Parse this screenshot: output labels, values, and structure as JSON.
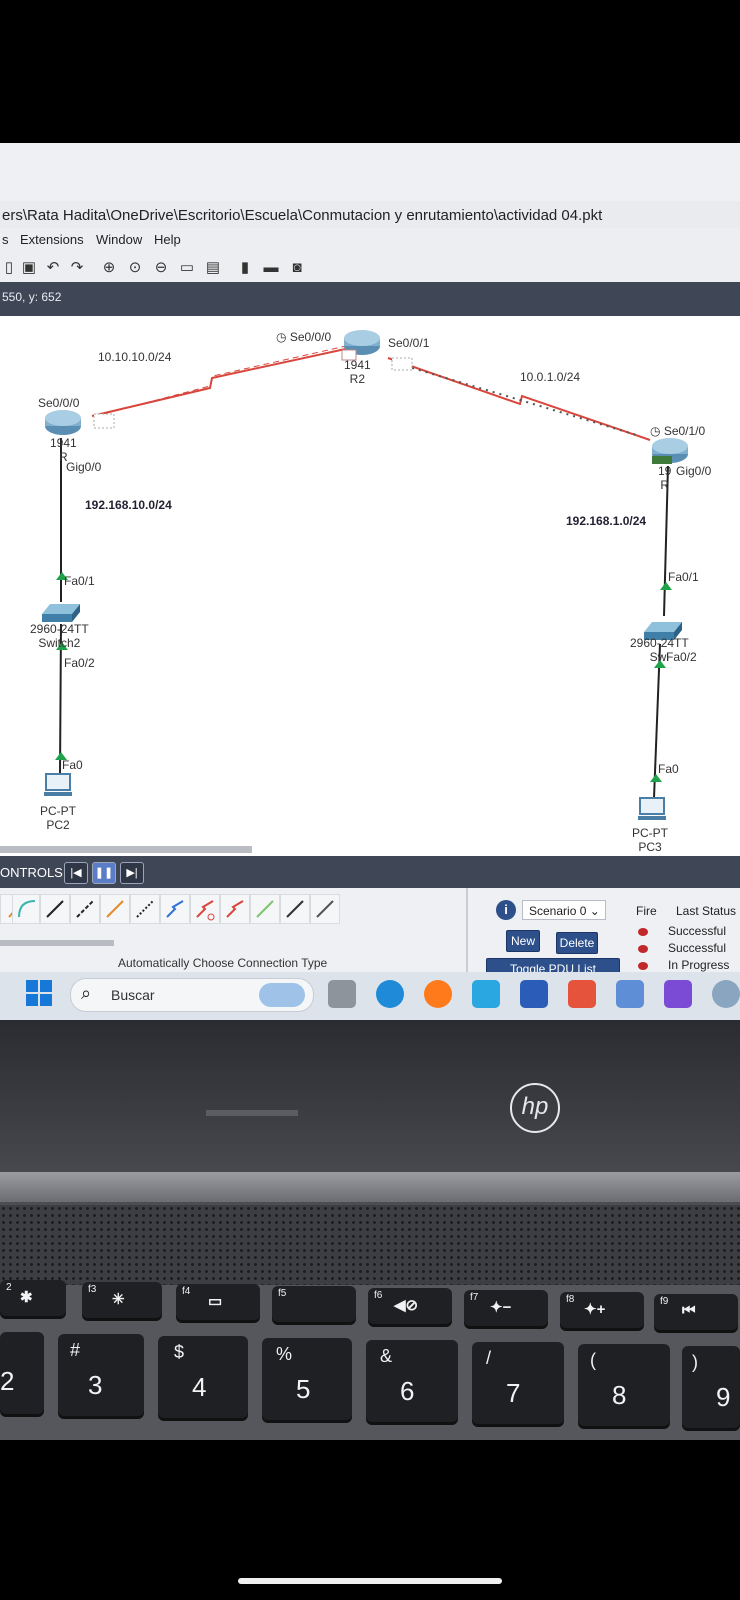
{
  "window": {
    "title_path": "ers\\Rata Hadita\\OneDrive\\Escritorio\\Escuela\\Conmutacion y enrutamiento\\actividad 04.pkt"
  },
  "menu": [
    "s",
    "Extensions",
    "Window",
    "Help"
  ],
  "coords": "550, y: 652",
  "topology": {
    "networks": {
      "net_left_serial": "10.10.10.0/24",
      "net_right_serial": "10.0.1.0/24",
      "lan_left": "192.168.10.0/24",
      "lan_right": "192.168.1.0/24"
    },
    "r2": {
      "model": "1941",
      "name": "R2",
      "port_left": "Se0/0/0",
      "port_right": "Se0/0/1"
    },
    "r1": {
      "model": "1941",
      "name": "R",
      "port_serial": "Se0/0/0",
      "port_gig": "Gig0/0"
    },
    "r3": {
      "model": "19",
      "name": "R",
      "port_serial": "Se0/1/0",
      "port_gig": "Gig0/0"
    },
    "switch2": {
      "model": "2960-24TT",
      "name": "Switch2",
      "port_up": "Fa0/1",
      "port_down": "Fa0/2"
    },
    "switch3": {
      "model": "2960-24TT",
      "name": "Swi",
      "port_up": "Fa0/1",
      "port_down": "Fa0/2"
    },
    "pc2": {
      "type": "PC-PT",
      "name": "PC2",
      "port": "Fa0"
    },
    "pc3": {
      "type": "PC-PT",
      "name": "PC3",
      "port": "Fa0"
    }
  },
  "controls": {
    "label": "ONTROLS:",
    "back_icon": "step-back-icon",
    "pause_icon": "pause-icon",
    "forward_icon": "step-forward-icon"
  },
  "connection": {
    "status": "Automatically Choose Connection Type"
  },
  "scenario": {
    "selected": "Scenario 0",
    "new_label": "New",
    "delete_label": "Delete",
    "toggle_label": "Toggle PDU List Window"
  },
  "pdu_status": {
    "fire_label": "Fire",
    "last_status_label": "Last Status",
    "rows": [
      "Successful",
      "Successful",
      "In Progress"
    ]
  },
  "taskbar": {
    "search_placeholder": "Buscar"
  },
  "laptop": {
    "brand": "hp",
    "keys_fn": [
      {
        "fn": "2",
        "sym": "✱"
      },
      {
        "fn": "f3",
        "sym": "✳"
      },
      {
        "fn": "f4",
        "sym": "▭"
      },
      {
        "fn": "f5",
        "sym": ""
      },
      {
        "fn": "f6",
        "sym": "◀⊘"
      },
      {
        "fn": "f7",
        "sym": "✦−"
      },
      {
        "fn": "f8",
        "sym": "✦+"
      },
      {
        "fn": "f9",
        "sym": "⏮"
      }
    ],
    "keys_num": [
      {
        "top": "",
        "main": "2"
      },
      {
        "top": "#",
        "main": "3"
      },
      {
        "top": "$",
        "main": "4"
      },
      {
        "top": "%",
        "main": "5"
      },
      {
        "top": "&",
        "main": "6"
      },
      {
        "top": "/",
        "main": "7"
      },
      {
        "top": "(",
        "main": "8"
      },
      {
        "top": ")",
        "main": "9"
      }
    ]
  }
}
